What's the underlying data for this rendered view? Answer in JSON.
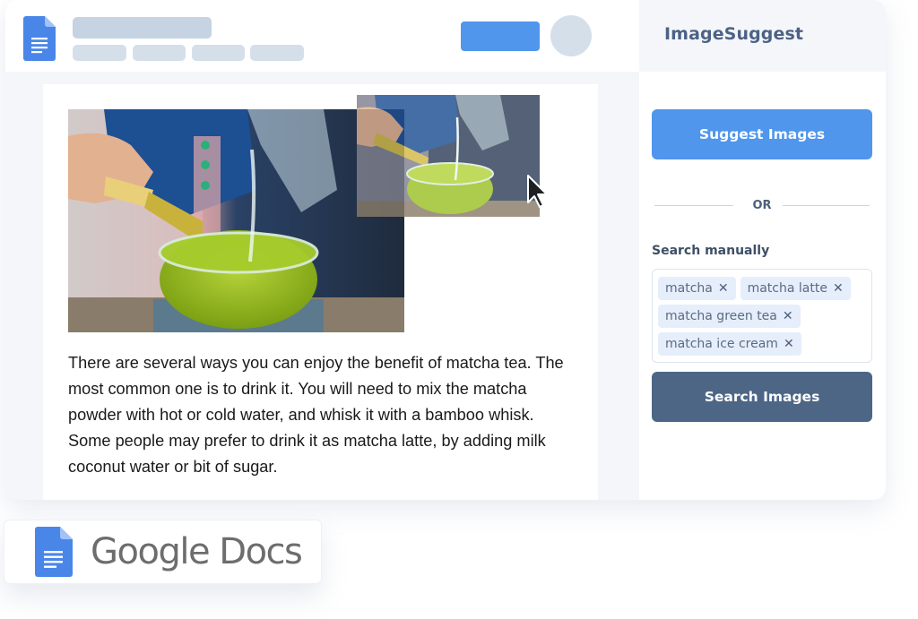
{
  "app": {
    "window_icon": "google-docs-icon"
  },
  "document": {
    "paragraph": "There are several ways you can enjoy the benefit of matcha tea. The most common one is to drink it. You will need to mix the matcha powder with hot or cold water, and whisk it with a bamboo whisk. Some people may prefer to drink it as matcha latte, by adding milk coconut water or bit of sugar.",
    "image_description": "Matcha being whisked with bamboo whisk while water is poured into a glass bowl"
  },
  "sidebar": {
    "title": "ImageSuggest",
    "suggest_button": "Suggest Images",
    "divider_text": "OR",
    "manual_label": "Search manually",
    "tags": [
      {
        "label": "matcha"
      },
      {
        "label": "matcha latte"
      },
      {
        "label": "matcha green tea"
      },
      {
        "label": "matcha ice cream"
      }
    ],
    "tag_remove_glyph": "✕",
    "search_button": "Search Images"
  },
  "badge": {
    "label": "Google Docs"
  },
  "colors": {
    "primary_blue": "#4f96ec",
    "slate_button": "#4d6686",
    "tag_bg": "#e6eefb",
    "title_text": "#4c6285"
  }
}
